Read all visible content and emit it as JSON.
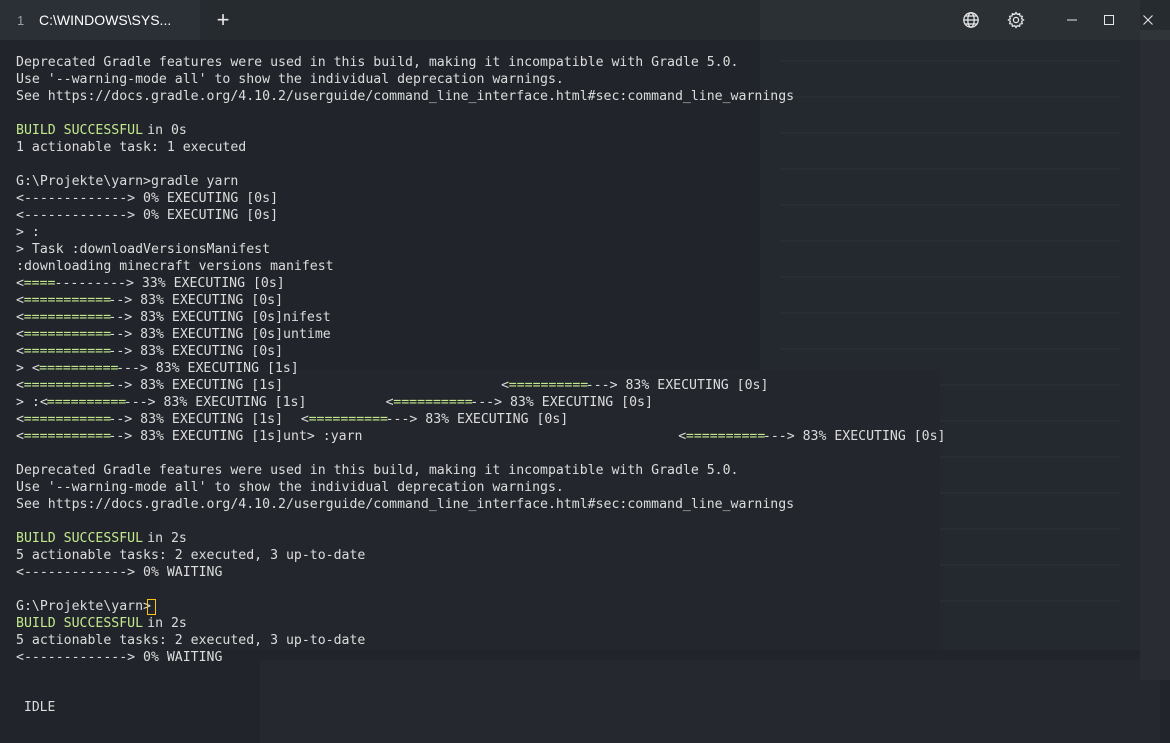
{
  "window": {
    "tab_index": "1",
    "tab_title": "C:\\WINDOWS\\SYS...",
    "new_tab_label": "+"
  },
  "terminal": {
    "lines": [
      {
        "segs": [
          {
            "t": "Deprecated Gradle features were used in this build, making it incompatible with Gradle 5.0."
          }
        ]
      },
      {
        "segs": [
          {
            "t": "Use '--warning-mode all' to show the individual deprecation warnings."
          }
        ]
      },
      {
        "segs": [
          {
            "t": "See https://docs.gradle.org/4.10.2/userguide/command_line_interface.html#sec:command_line_warnings"
          }
        ]
      },
      {
        "segs": []
      },
      {
        "segs": [
          {
            "t": "BUILD SUCCESSFUL",
            "c": "green"
          },
          {
            "t": " in 0s"
          }
        ]
      },
      {
        "segs": [
          {
            "t": "1 actionable task: 1 executed"
          }
        ]
      },
      {
        "segs": []
      },
      {
        "segs": [
          {
            "t": "G:\\Projekte\\yarn>gradle yarn"
          }
        ]
      },
      {
        "segs": [
          {
            "t": "<-------------> 0% EXECUTING [0s]"
          }
        ]
      },
      {
        "segs": [
          {
            "t": "<-------------> 0% EXECUTING [0s]"
          }
        ]
      },
      {
        "segs": [
          {
            "t": "> :"
          }
        ]
      },
      {
        "segs": [
          {
            "t": "> Task :downloadVersionsManifest"
          }
        ]
      },
      {
        "segs": [
          {
            "t": ":downloading minecraft versions manifest"
          }
        ]
      },
      {
        "segs": [
          {
            "t": "<"
          },
          {
            "t": "====",
            "c": "green"
          },
          {
            "t": "---------> 33% EXECUTING [0s]"
          }
        ]
      },
      {
        "segs": [
          {
            "t": "<"
          },
          {
            "t": "===========",
            "c": "green"
          },
          {
            "t": "--> 83% EXECUTING [0s]"
          }
        ]
      },
      {
        "segs": [
          {
            "t": "<"
          },
          {
            "t": "===========",
            "c": "green"
          },
          {
            "t": "--> 83% EXECUTING [0s]nifest"
          }
        ]
      },
      {
        "segs": [
          {
            "t": "<"
          },
          {
            "t": "===========",
            "c": "green"
          },
          {
            "t": "--> 83% EXECUTING [0s]untime"
          }
        ]
      },
      {
        "segs": [
          {
            "t": "<"
          },
          {
            "t": "===========",
            "c": "green"
          },
          {
            "t": "--> 83% EXECUTING [0s]"
          }
        ]
      },
      {
        "segs": [
          {
            "t": "> <"
          },
          {
            "t": "==========",
            "c": "green"
          },
          {
            "t": "---> 83% EXECUTING [1s]"
          }
        ]
      },
      {
        "segs": [
          {
            "t": "<"
          },
          {
            "t": "===========",
            "c": "green"
          },
          {
            "t": "--> 83% EXECUTING [1s]"
          },
          {
            "t": "<",
            "x": 63
          },
          {
            "t": "==========",
            "c": "green"
          },
          {
            "t": "---> 83% EXECUTING [0s]"
          }
        ]
      },
      {
        "segs": [
          {
            "t": "> :<"
          },
          {
            "t": "==========",
            "c": "green"
          },
          {
            "t": "---> 83% EXECUTING [1s]"
          },
          {
            "t": "<",
            "x": 48
          },
          {
            "t": "==========",
            "c": "green"
          },
          {
            "t": "---> 83% EXECUTING [0s]"
          }
        ]
      },
      {
        "segs": [
          {
            "t": "<"
          },
          {
            "t": "===========",
            "c": "green"
          },
          {
            "t": "--> 83% EXECUTING [1s]"
          },
          {
            "t": "<",
            "x": 37
          },
          {
            "t": "==========",
            "c": "green"
          },
          {
            "t": "---> 83% EXECUTING [0s]"
          }
        ]
      },
      {
        "segs": [
          {
            "t": "<"
          },
          {
            "t": "===========",
            "c": "green"
          },
          {
            "t": "--> 83% EXECUTING [1s]unt> :yarn"
          },
          {
            "t": "<",
            "x": 86
          },
          {
            "t": "==========",
            "c": "green"
          },
          {
            "t": "---> 83% EXECUTING [0s]"
          }
        ]
      },
      {
        "segs": []
      },
      {
        "segs": [
          {
            "t": "Deprecated Gradle features were used in this build, making it incompatible with Gradle 5.0."
          }
        ]
      },
      {
        "segs": [
          {
            "t": "Use '--warning-mode all' to show the individual deprecation warnings."
          }
        ]
      },
      {
        "segs": [
          {
            "t": "See https://docs.gradle.org/4.10.2/userguide/command_line_interface.html#sec:command_line_warnings"
          }
        ]
      },
      {
        "segs": []
      },
      {
        "segs": [
          {
            "t": "BUILD SUCCESSFUL",
            "c": "green"
          },
          {
            "t": " in 2s"
          }
        ]
      },
      {
        "segs": [
          {
            "t": "5 actionable tasks: 2 executed, 3 up-to-date"
          }
        ]
      },
      {
        "segs": [
          {
            "t": "<-------------> 0% WAITING"
          }
        ]
      },
      {
        "segs": []
      },
      {
        "segs": [
          {
            "t": "G:\\Projekte\\yarn>"
          },
          {
            "cursor": true
          }
        ]
      },
      {
        "segs": [
          {
            "t": "BUILD SUCCESSFUL",
            "c": "green"
          },
          {
            "t": " in 2s"
          }
        ]
      },
      {
        "segs": [
          {
            "t": "5 actionable tasks: 2 executed, 3 up-to-date"
          }
        ]
      },
      {
        "segs": [
          {
            "t": "<-------------> 0% WAITING"
          }
        ]
      }
    ]
  },
  "status": {
    "text": "IDLE"
  },
  "colors": {
    "accent_green": "#c3e88d",
    "cursor": "#f5c518",
    "text": "#dcdcdc"
  },
  "icons": [
    "globe-icon",
    "gear-icon",
    "minimize-icon",
    "maximize-icon",
    "close-icon"
  ]
}
